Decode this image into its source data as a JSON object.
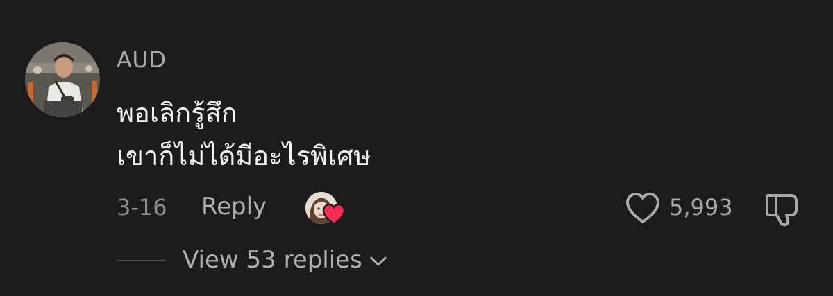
{
  "comment": {
    "username": "AUD",
    "text_lines": [
      "พอเลิกรู้สึก",
      "เขาก็ไม่ได้มีอะไรพิเศษ"
    ],
    "date": "3-16",
    "reply_label": "Reply",
    "like_count": "5,993",
    "view_replies_label": "View 53 replies"
  },
  "icons": {
    "like": "heart-outline-icon",
    "dislike": "thumbs-down-icon",
    "creator_like": "heart-filled-icon",
    "expand": "chevron-down-icon"
  },
  "colors": {
    "background": "#1c1c1c",
    "text_primary": "#f4f4f4",
    "text_secondary": "#a9a9a9",
    "heart_accent": "#fe2c55"
  }
}
